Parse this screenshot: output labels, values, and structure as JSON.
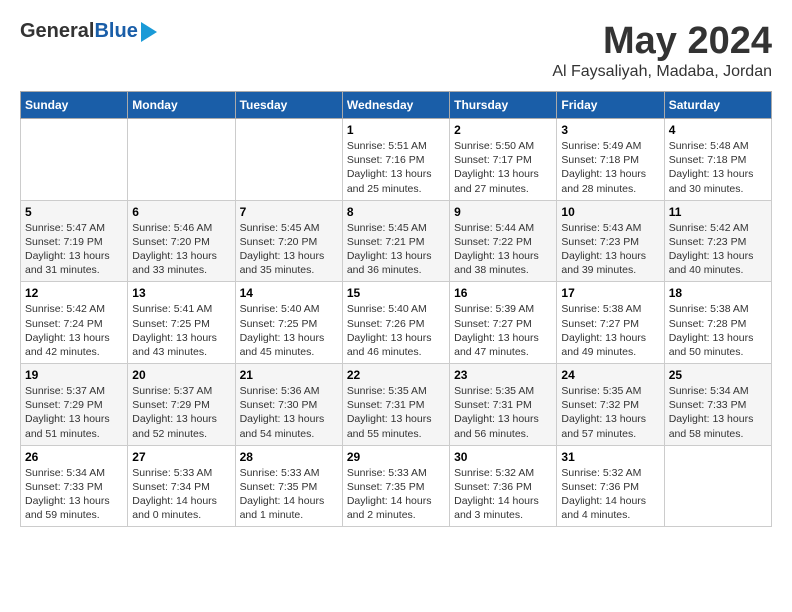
{
  "logo": {
    "line1": "General",
    "line2": "Blue"
  },
  "title": "May 2024",
  "subtitle": "Al Faysaliyah, Madaba, Jordan",
  "days_of_week": [
    "Sunday",
    "Monday",
    "Tuesday",
    "Wednesday",
    "Thursday",
    "Friday",
    "Saturday"
  ],
  "weeks": [
    [
      {
        "num": "",
        "info": ""
      },
      {
        "num": "",
        "info": ""
      },
      {
        "num": "",
        "info": ""
      },
      {
        "num": "1",
        "info": "Sunrise: 5:51 AM\nSunset: 7:16 PM\nDaylight: 13 hours\nand 25 minutes."
      },
      {
        "num": "2",
        "info": "Sunrise: 5:50 AM\nSunset: 7:17 PM\nDaylight: 13 hours\nand 27 minutes."
      },
      {
        "num": "3",
        "info": "Sunrise: 5:49 AM\nSunset: 7:18 PM\nDaylight: 13 hours\nand 28 minutes."
      },
      {
        "num": "4",
        "info": "Sunrise: 5:48 AM\nSunset: 7:18 PM\nDaylight: 13 hours\nand 30 minutes."
      }
    ],
    [
      {
        "num": "5",
        "info": "Sunrise: 5:47 AM\nSunset: 7:19 PM\nDaylight: 13 hours\nand 31 minutes."
      },
      {
        "num": "6",
        "info": "Sunrise: 5:46 AM\nSunset: 7:20 PM\nDaylight: 13 hours\nand 33 minutes."
      },
      {
        "num": "7",
        "info": "Sunrise: 5:45 AM\nSunset: 7:20 PM\nDaylight: 13 hours\nand 35 minutes."
      },
      {
        "num": "8",
        "info": "Sunrise: 5:45 AM\nSunset: 7:21 PM\nDaylight: 13 hours\nand 36 minutes."
      },
      {
        "num": "9",
        "info": "Sunrise: 5:44 AM\nSunset: 7:22 PM\nDaylight: 13 hours\nand 38 minutes."
      },
      {
        "num": "10",
        "info": "Sunrise: 5:43 AM\nSunset: 7:23 PM\nDaylight: 13 hours\nand 39 minutes."
      },
      {
        "num": "11",
        "info": "Sunrise: 5:42 AM\nSunset: 7:23 PM\nDaylight: 13 hours\nand 40 minutes."
      }
    ],
    [
      {
        "num": "12",
        "info": "Sunrise: 5:42 AM\nSunset: 7:24 PM\nDaylight: 13 hours\nand 42 minutes."
      },
      {
        "num": "13",
        "info": "Sunrise: 5:41 AM\nSunset: 7:25 PM\nDaylight: 13 hours\nand 43 minutes."
      },
      {
        "num": "14",
        "info": "Sunrise: 5:40 AM\nSunset: 7:25 PM\nDaylight: 13 hours\nand 45 minutes."
      },
      {
        "num": "15",
        "info": "Sunrise: 5:40 AM\nSunset: 7:26 PM\nDaylight: 13 hours\nand 46 minutes."
      },
      {
        "num": "16",
        "info": "Sunrise: 5:39 AM\nSunset: 7:27 PM\nDaylight: 13 hours\nand 47 minutes."
      },
      {
        "num": "17",
        "info": "Sunrise: 5:38 AM\nSunset: 7:27 PM\nDaylight: 13 hours\nand 49 minutes."
      },
      {
        "num": "18",
        "info": "Sunrise: 5:38 AM\nSunset: 7:28 PM\nDaylight: 13 hours\nand 50 minutes."
      }
    ],
    [
      {
        "num": "19",
        "info": "Sunrise: 5:37 AM\nSunset: 7:29 PM\nDaylight: 13 hours\nand 51 minutes."
      },
      {
        "num": "20",
        "info": "Sunrise: 5:37 AM\nSunset: 7:29 PM\nDaylight: 13 hours\nand 52 minutes."
      },
      {
        "num": "21",
        "info": "Sunrise: 5:36 AM\nSunset: 7:30 PM\nDaylight: 13 hours\nand 54 minutes."
      },
      {
        "num": "22",
        "info": "Sunrise: 5:35 AM\nSunset: 7:31 PM\nDaylight: 13 hours\nand 55 minutes."
      },
      {
        "num": "23",
        "info": "Sunrise: 5:35 AM\nSunset: 7:31 PM\nDaylight: 13 hours\nand 56 minutes."
      },
      {
        "num": "24",
        "info": "Sunrise: 5:35 AM\nSunset: 7:32 PM\nDaylight: 13 hours\nand 57 minutes."
      },
      {
        "num": "25",
        "info": "Sunrise: 5:34 AM\nSunset: 7:33 PM\nDaylight: 13 hours\nand 58 minutes."
      }
    ],
    [
      {
        "num": "26",
        "info": "Sunrise: 5:34 AM\nSunset: 7:33 PM\nDaylight: 13 hours\nand 59 minutes."
      },
      {
        "num": "27",
        "info": "Sunrise: 5:33 AM\nSunset: 7:34 PM\nDaylight: 14 hours\nand 0 minutes."
      },
      {
        "num": "28",
        "info": "Sunrise: 5:33 AM\nSunset: 7:35 PM\nDaylight: 14 hours\nand 1 minute."
      },
      {
        "num": "29",
        "info": "Sunrise: 5:33 AM\nSunset: 7:35 PM\nDaylight: 14 hours\nand 2 minutes."
      },
      {
        "num": "30",
        "info": "Sunrise: 5:32 AM\nSunset: 7:36 PM\nDaylight: 14 hours\nand 3 minutes."
      },
      {
        "num": "31",
        "info": "Sunrise: 5:32 AM\nSunset: 7:36 PM\nDaylight: 14 hours\nand 4 minutes."
      },
      {
        "num": "",
        "info": ""
      }
    ]
  ]
}
